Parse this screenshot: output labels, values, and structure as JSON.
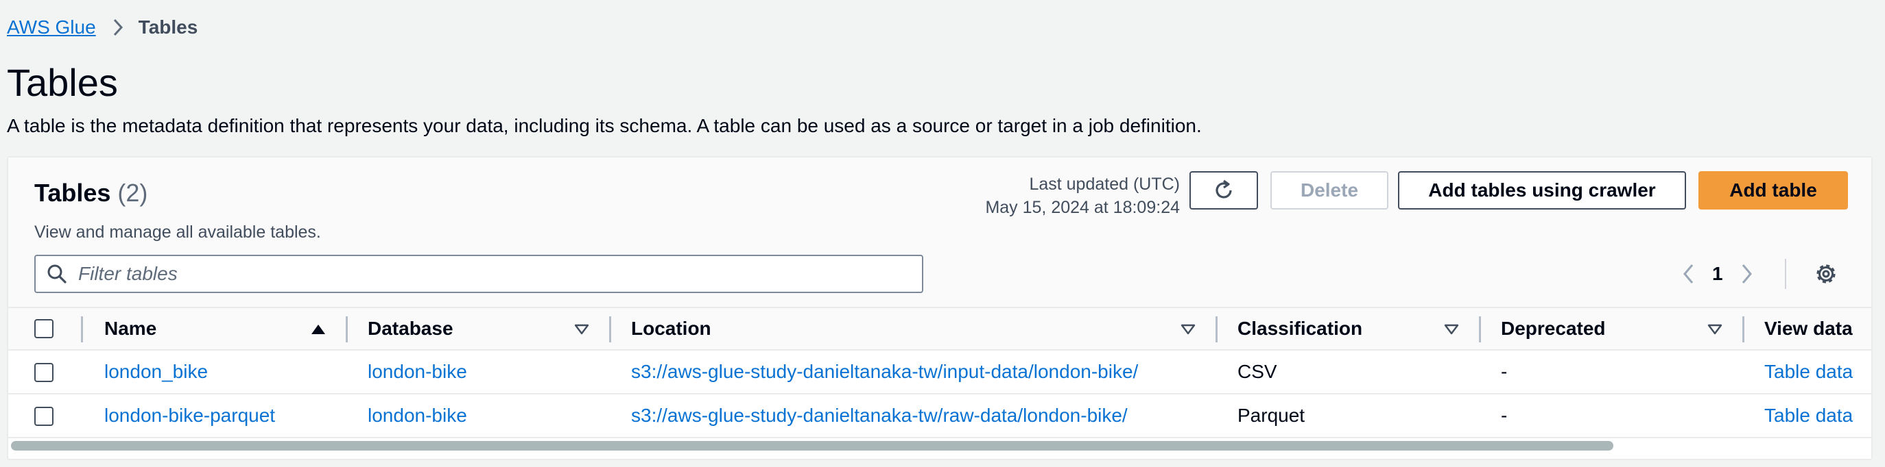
{
  "breadcrumb": {
    "root": "AWS Glue",
    "current": "Tables"
  },
  "page": {
    "title": "Tables",
    "description": "A table is the metadata definition that represents your data, including its schema. A table can be used as a source or target in a job definition."
  },
  "panel": {
    "title": "Tables",
    "count": "(2)",
    "description": "View and manage all available tables.",
    "last_updated_label": "Last updated (UTC)",
    "last_updated_value": "May 15, 2024 at 18:09:24",
    "buttons": {
      "delete": "Delete",
      "crawler": "Add tables using crawler",
      "add": "Add table"
    },
    "filter_placeholder": "Filter tables",
    "page_number": "1"
  },
  "table": {
    "headers": {
      "name": "Name",
      "database": "Database",
      "location": "Location",
      "classification": "Classification",
      "deprecated": "Deprecated",
      "view_data": "View data"
    },
    "sort": {
      "column": "name",
      "direction": "ascending"
    },
    "rows": [
      {
        "name": "london_bike",
        "database": "london-bike",
        "location": "s3://aws-glue-study-danieltanaka-tw/input-data/london-bike/",
        "classification": "CSV",
        "deprecated": "-",
        "view_data": "Table data"
      },
      {
        "name": "london-bike-parquet",
        "database": "london-bike",
        "location": "s3://aws-glue-study-danieltanaka-tw/raw-data/london-bike/",
        "classification": "Parquet",
        "deprecated": "-",
        "view_data": "Table data"
      }
    ]
  },
  "icons": {
    "breadcrumb_separator": "chevron-right-icon",
    "refresh": "refresh-icon",
    "filter": "search-icon",
    "previous_page": "chevron-left-icon",
    "next_page": "chevron-right-icon",
    "settings": "gear-icon",
    "sorted_column": "caret-up-filled-icon",
    "sortable_column": "caret-down-outline-icon"
  },
  "colors": {
    "link": "#0972d3",
    "primary_button": "#f29b3b",
    "text": "#000716",
    "secondary_text": "#414d5c",
    "page_background": "#f2f3f3"
  }
}
